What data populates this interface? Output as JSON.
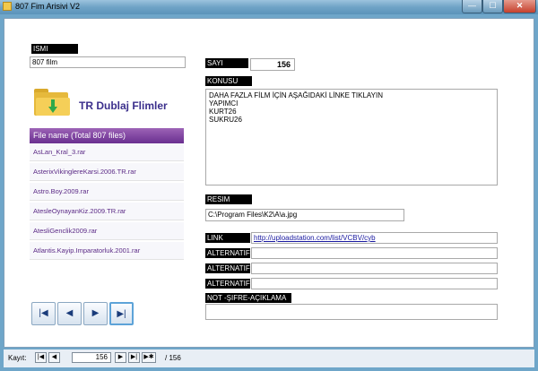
{
  "window": {
    "title": "807 Fim Arisivi V2",
    "min_glyph": "—",
    "max_glyph": "☐",
    "close_glyph": "✕"
  },
  "form": {
    "isim_label": "ISMI",
    "isim_value": "807 film",
    "sayi_label": "SAYI",
    "sayi_value": "156",
    "konusu_label": "KONUSU",
    "konusu_text": "DAHA FAZLA FİLM İÇİN AŞAĞIDAKİ LİNKE TIKLAYIN\nYAPIMCI\nKURT26\nSUKRU26",
    "resim_label": "RESIM",
    "resim_path": "C:\\Program Files\\K2\\A\\a.jpg",
    "link_label": "LINK",
    "link_value": "http://uploadstation.com/list/VCBV/cyb",
    "alt1_label": "ALTERNATIF",
    "alt2_label": "ALTERNATIF",
    "alt3_label": "ALTERNATIF",
    "not_label": "NOT -ŞIFRE-AÇIKLAMA"
  },
  "panel": {
    "title": "TR Dublaj Flimler",
    "header": "File name (Total 807 files)",
    "files": [
      "AsLan_Kral_3.rar",
      "AsterixVikinglereKarsi.2006.TR.rar",
      "Astro.Boy.2009.rar",
      "AtesleOynayanKiz.2009.TR.rar",
      "AtesliGenclik2009.rar",
      "Atlantis.Kayip.Imparatorluk.2001.rar"
    ]
  },
  "nav": {
    "first": "|◀",
    "prev": "◀",
    "next": "▶",
    "last": "▶|"
  },
  "statusbar": {
    "label": "Kayıt:",
    "first": "|◀",
    "prev": "◀",
    "record": "156",
    "next": "▶",
    "last": "▶|",
    "new": "▶✱",
    "of": "/ 156"
  }
}
